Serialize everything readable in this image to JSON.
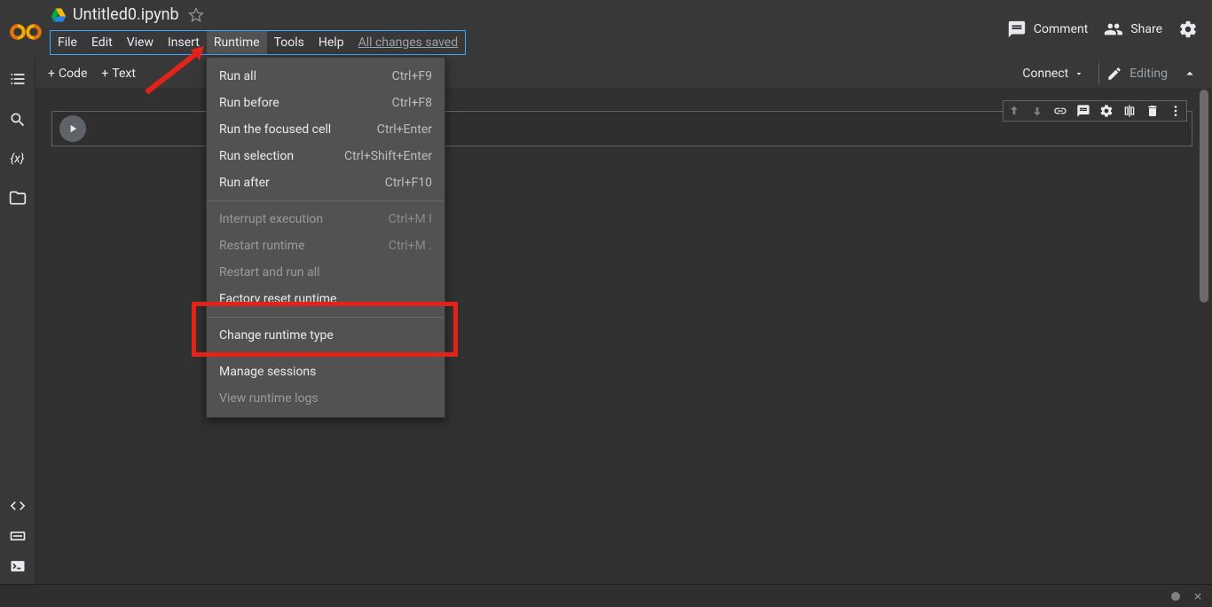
{
  "header": {
    "doc_title": "Untitled0.ipynb",
    "comment_label": "Comment",
    "share_label": "Share"
  },
  "menubar": {
    "file": "File",
    "edit": "Edit",
    "view": "View",
    "insert": "Insert",
    "runtime": "Runtime",
    "tools": "Tools",
    "help": "Help",
    "saved": "All changes saved"
  },
  "toolbar": {
    "code": "Code",
    "text": "Text",
    "connect": "Connect",
    "editing": "Editing"
  },
  "runtime_menu": {
    "run_all": {
      "label": "Run all",
      "shortcut": "Ctrl+F9"
    },
    "run_before": {
      "label": "Run before",
      "shortcut": "Ctrl+F8"
    },
    "run_focused": {
      "label": "Run the focused cell",
      "shortcut": "Ctrl+Enter"
    },
    "run_selection": {
      "label": "Run selection",
      "shortcut": "Ctrl+Shift+Enter"
    },
    "run_after": {
      "label": "Run after",
      "shortcut": "Ctrl+F10"
    },
    "interrupt": {
      "label": "Interrupt execution",
      "shortcut": "Ctrl+M I"
    },
    "restart": {
      "label": "Restart runtime",
      "shortcut": "Ctrl+M ."
    },
    "restart_all": {
      "label": "Restart and run all"
    },
    "factory_reset": {
      "label": "Factory reset runtime"
    },
    "change_type": {
      "label": "Change runtime type"
    },
    "manage": {
      "label": "Manage sessions"
    },
    "view_logs": {
      "label": "View runtime logs"
    }
  },
  "left_rail": {
    "variables_glyph": "{x}"
  }
}
